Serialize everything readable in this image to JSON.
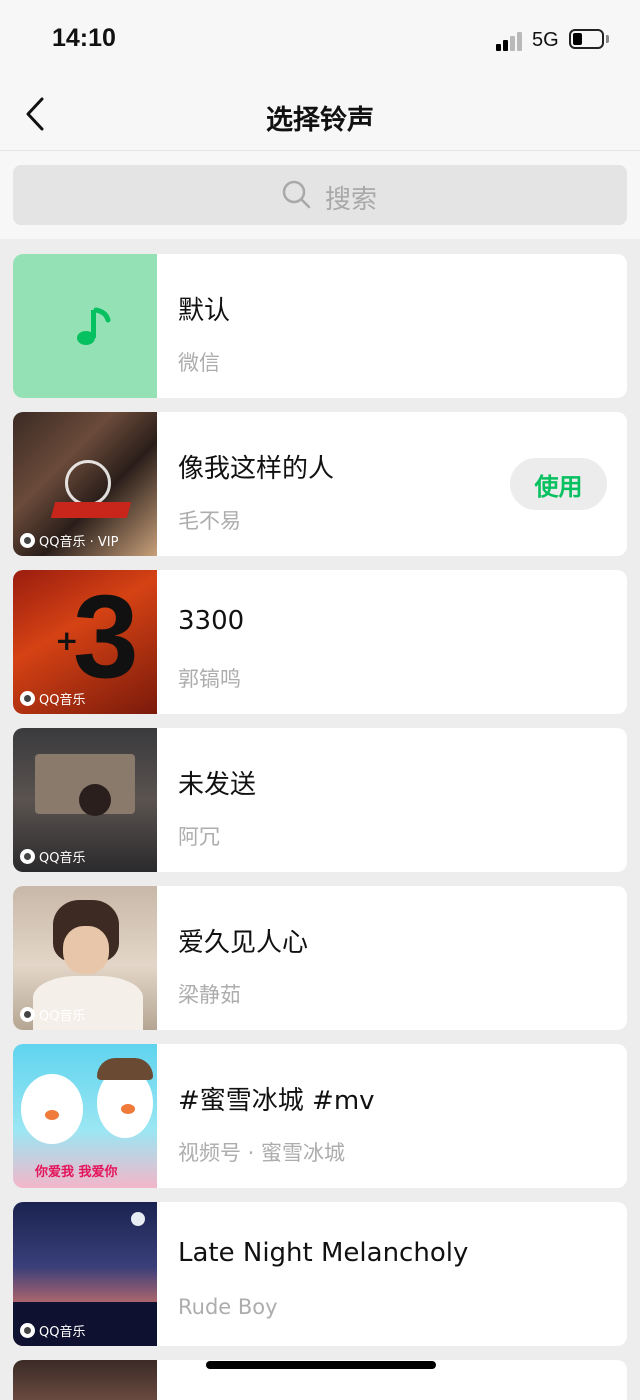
{
  "status": {
    "time": "14:10",
    "network": "5G"
  },
  "nav": {
    "title": "选择铃声"
  },
  "search": {
    "placeholder": "搜索"
  },
  "colors": {
    "accent": "#07c160",
    "default_thumb_bg": "#95e1b6"
  },
  "ringtones": [
    {
      "title": "默认",
      "subtitle": "微信",
      "badge": "",
      "icon": "music-note-icon"
    },
    {
      "title": "像我这样的人",
      "subtitle": "毛不易",
      "badge": "QQ音乐 · VIP",
      "action": "使用"
    },
    {
      "title": "3300",
      "subtitle": "郭镐鸣",
      "badge": "QQ音乐"
    },
    {
      "title": "未发送",
      "subtitle": "阿冗",
      "badge": "QQ音乐"
    },
    {
      "title": "爱久见人心",
      "subtitle": "梁静茹",
      "badge": "QQ音乐"
    },
    {
      "title": "#蜜雪冰城 #mv",
      "subtitle": "视频号 · 蜜雪冰城",
      "badge": "",
      "thumb_caption": "你爱我 我爱你"
    },
    {
      "title": "Late Night Melancholy",
      "subtitle": "Rude Boy",
      "badge": "QQ音乐"
    }
  ]
}
